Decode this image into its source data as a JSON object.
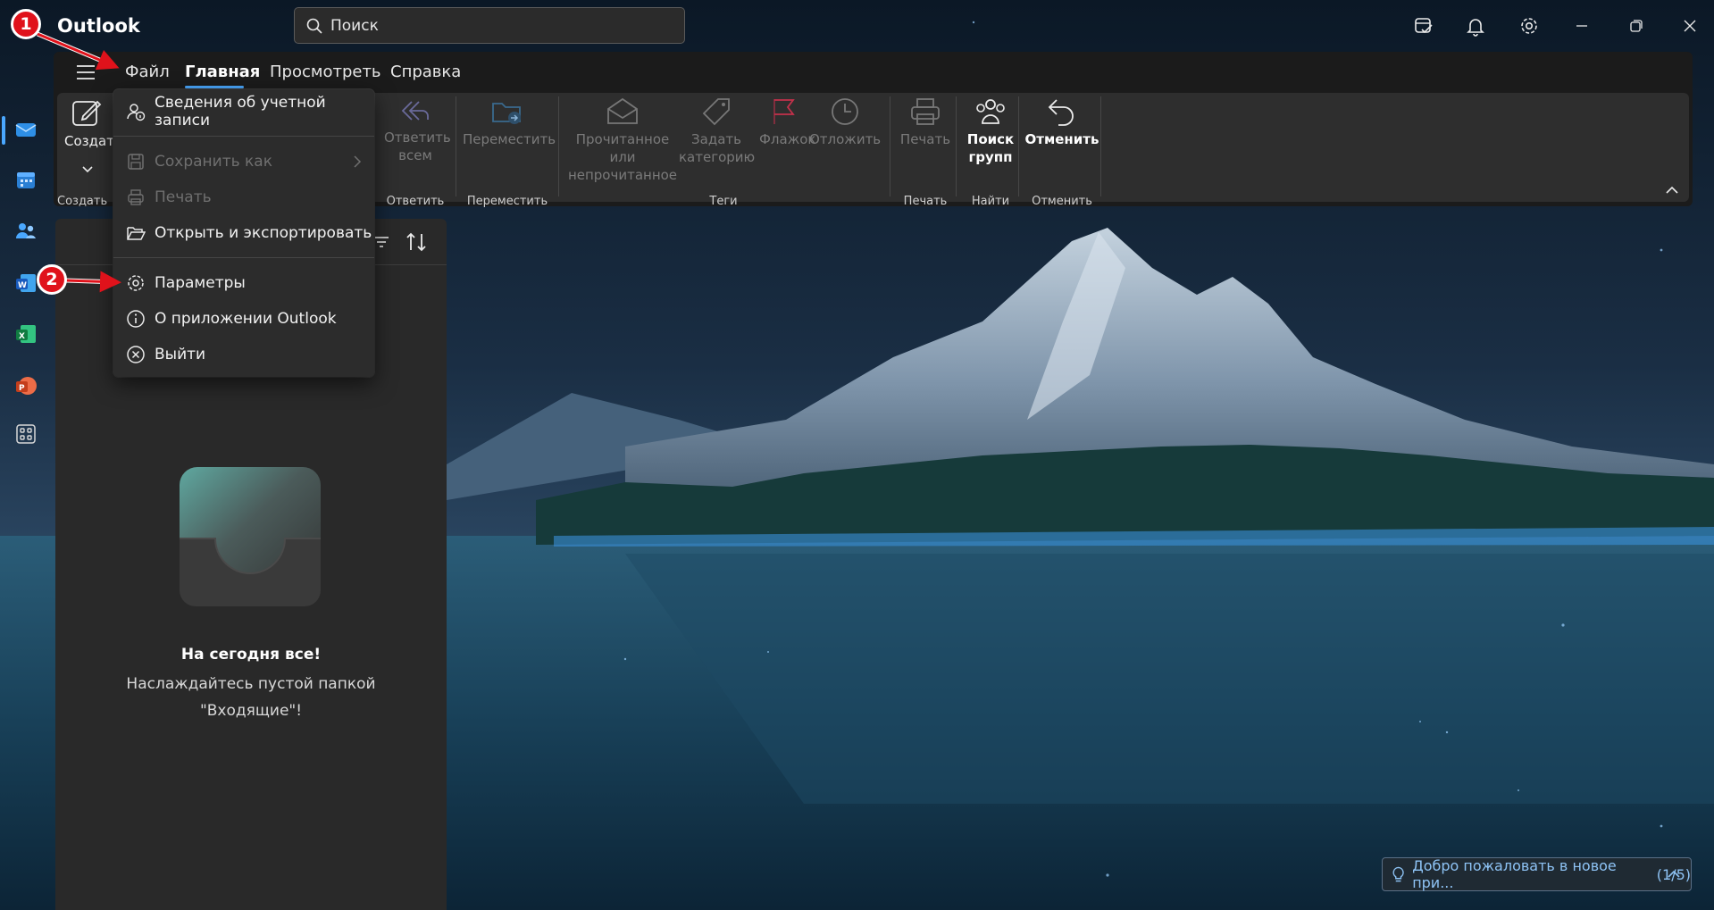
{
  "app": {
    "title": "Outlook"
  },
  "search": {
    "placeholder": "Поиск"
  },
  "tabs": [
    {
      "label": "Файл"
    },
    {
      "label": "Главная"
    },
    {
      "label": "Просмотреть"
    },
    {
      "label": "Справка"
    }
  ],
  "ribbon": {
    "create": {
      "label": "Создать",
      "group": "Создать"
    },
    "reply_all": {
      "label": "Ответить всем",
      "line1": "Ответить",
      "line2": "всем",
      "group": "Ответить"
    },
    "move": {
      "label": "Переместить",
      "group": "Переместить"
    },
    "read_unread": {
      "line1": "Прочитанное или",
      "line2": "непрочитанное"
    },
    "categorize": {
      "line1": "Задать",
      "line2": "категорию"
    },
    "flag": {
      "label": "Флажок"
    },
    "snooze": {
      "label": "Отложить"
    },
    "tags_group": "Теги",
    "print": {
      "label": "Печать",
      "group": "Печать"
    },
    "find_groups": {
      "line1": "Поиск",
      "line2": "групп",
      "group": "Найти"
    },
    "undo": {
      "label": "Отменить",
      "group": "Отменить"
    }
  },
  "file_menu": {
    "items": [
      {
        "label": "Сведения об учетной записи",
        "enabled": true
      },
      {
        "label": "Сохранить как",
        "enabled": false
      },
      {
        "label": "Печать",
        "enabled": false
      },
      {
        "label": "Открыть и экспортировать",
        "enabled": true
      },
      {
        "label": "Параметры",
        "enabled": true
      },
      {
        "label": "О приложении Outlook",
        "enabled": true
      },
      {
        "label": "Выйти",
        "enabled": true
      }
    ]
  },
  "inbox": {
    "empty_title": "На сегодня все!",
    "empty_line1": "Наслаждайтесь пустой папкой",
    "empty_line2": "\"Входящие\"!"
  },
  "annotations": {
    "step1": "1",
    "step2": "2"
  },
  "toast": {
    "text": "Добро пожаловать в новое при...",
    "count": "(1/5)"
  },
  "colors": {
    "accent": "#4aa8ff",
    "annotation_red": "#e0121b",
    "flag_red": "#c4314b"
  }
}
